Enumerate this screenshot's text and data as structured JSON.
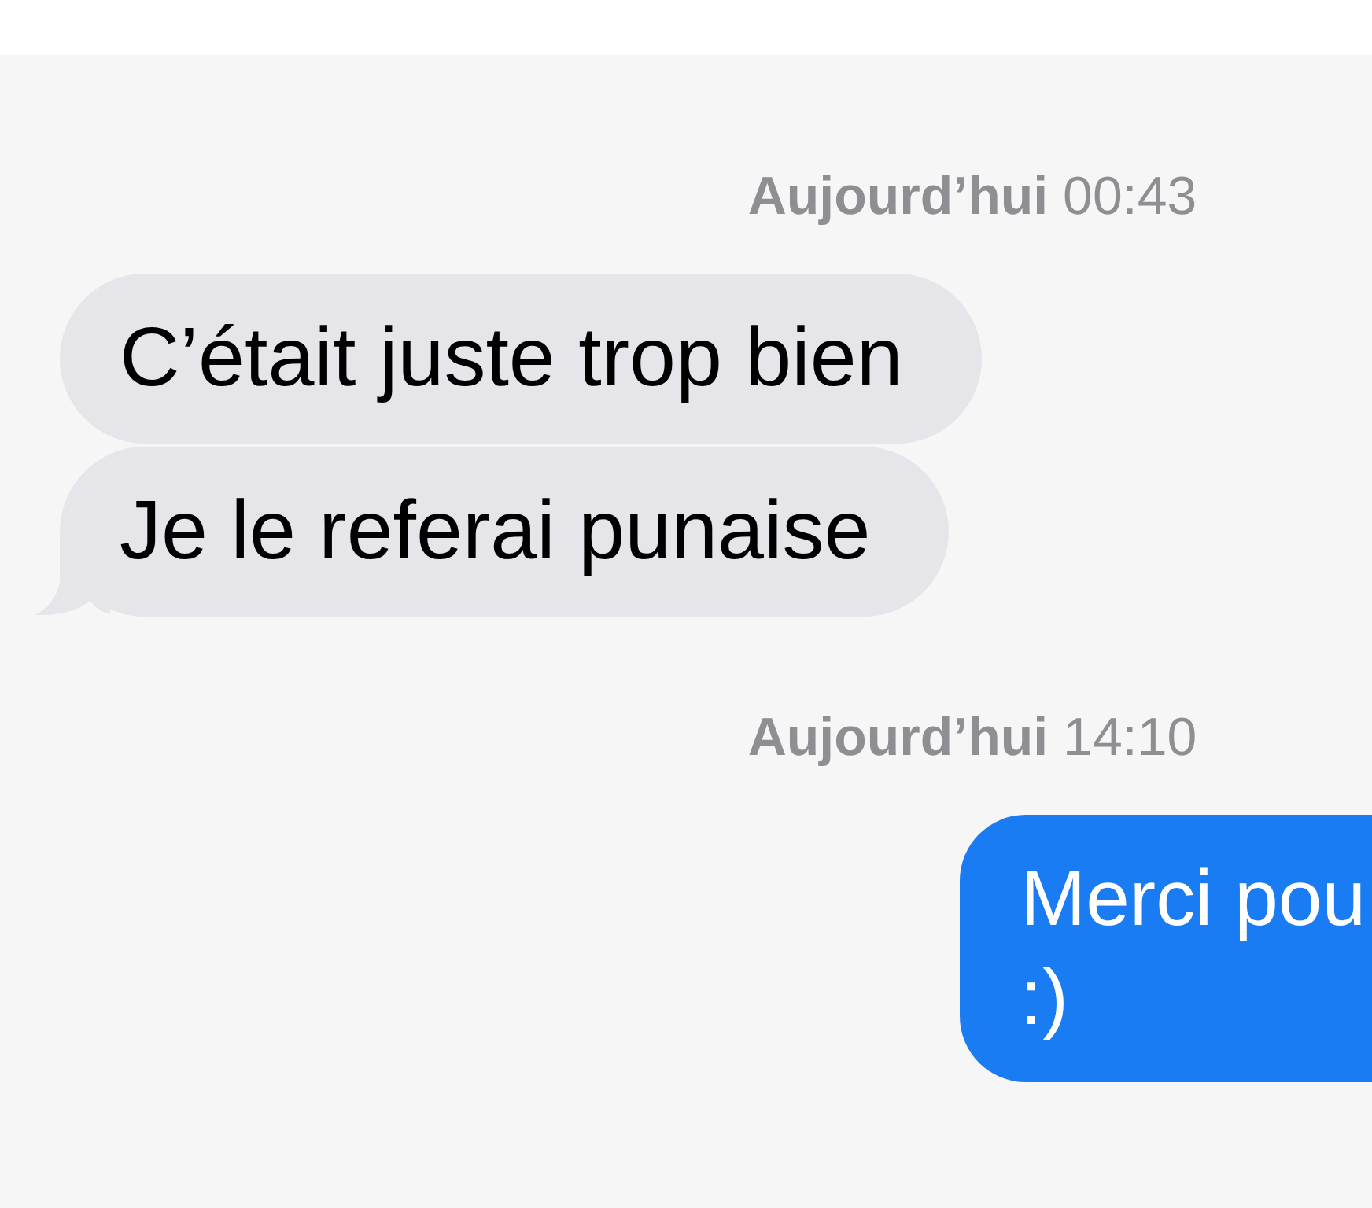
{
  "thread": [
    {
      "kind": "timestamp",
      "text": "**Aujourd’hui** 00:43"
    },
    {
      "kind": "received",
      "lines": [
        "C’était juste trop bien"
      ],
      "tail": false
    },
    {
      "kind": "received",
      "lines": [
        "Je le referai punaise"
      ],
      "tail": true
    },
    {
      "kind": "timestamp",
      "text": "**Aujourd’hui** 14:10"
    },
    {
      "kind": "sent",
      "lines": [
        "Merci pou",
        ":)"
      ],
      "tail": false
    }
  ]
}
